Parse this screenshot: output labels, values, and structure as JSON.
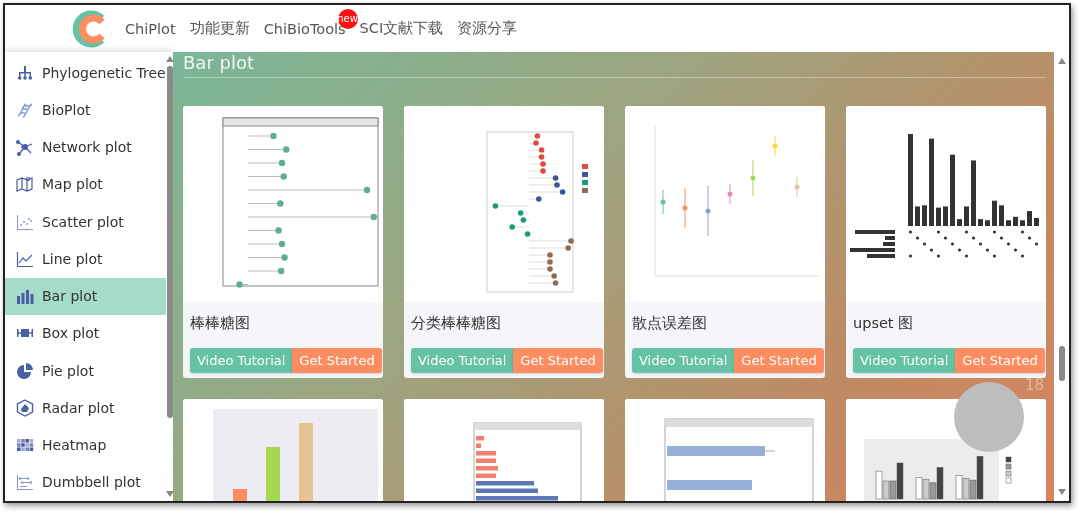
{
  "nav": {
    "items": [
      {
        "label": "ChiPlot"
      },
      {
        "label": "功能更新"
      },
      {
        "label": "ChiBioTools",
        "badge": "new"
      },
      {
        "label": "SCI文献下载"
      },
      {
        "label": "资源分享"
      }
    ]
  },
  "sidebar": {
    "items": [
      {
        "label": "Phylogenetic Tree",
        "selected": false
      },
      {
        "label": "BioPlot",
        "selected": false
      },
      {
        "label": "Network plot",
        "selected": false
      },
      {
        "label": "Map plot",
        "selected": false
      },
      {
        "label": "Scatter plot",
        "selected": false
      },
      {
        "label": "Line plot",
        "selected": false
      },
      {
        "label": "Bar plot",
        "selected": true
      },
      {
        "label": "Box plot",
        "selected": false
      },
      {
        "label": "Pie plot",
        "selected": false
      },
      {
        "label": "Radar plot",
        "selected": false
      },
      {
        "label": "Heatmap",
        "selected": false
      },
      {
        "label": "Dumbbell plot",
        "selected": false
      }
    ]
  },
  "section": {
    "title": "Bar plot"
  },
  "cards": [
    {
      "kind": "lollipop",
      "title": "棒棒糖图",
      "buttons": [
        "Video Tutorial",
        "Get Started"
      ]
    },
    {
      "kind": "grouped-lollipop",
      "title": "分类棒棒糖图",
      "buttons": [
        "Video Tutorial",
        "Get Started"
      ]
    },
    {
      "kind": "errorbar",
      "title": "散点误差图",
      "buttons": [
        "Video Tutorial",
        "Get Started"
      ]
    },
    {
      "kind": "upset",
      "title": "upset 图",
      "buttons": [
        "Video Tutorial",
        "Get Started"
      ]
    },
    {
      "kind": "bar"
    },
    {
      "kind": "hbar"
    },
    {
      "kind": "hbar-error"
    },
    {
      "kind": "grouped-bar"
    }
  ],
  "floating_widget": {
    "count": "18"
  }
}
